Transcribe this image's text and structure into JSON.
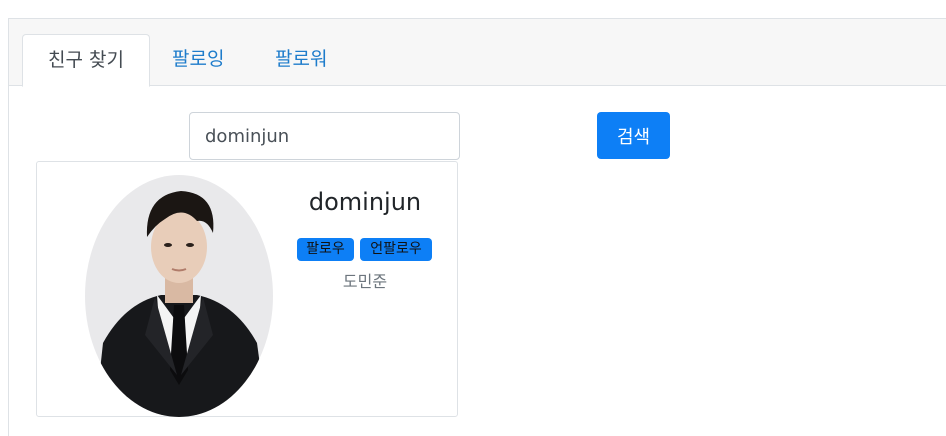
{
  "tabs": [
    {
      "label": "친구 찾기",
      "active": true
    },
    {
      "label": "팔로잉",
      "active": false
    },
    {
      "label": "팔로워",
      "active": false
    }
  ],
  "search": {
    "value": "dominjun",
    "button_label": "검색"
  },
  "result_card": {
    "username": "dominjun",
    "follow_label": "팔로우",
    "unfollow_label": "언팔로우",
    "real_name": "도민준"
  },
  "colors": {
    "accent": "#0d7ff6",
    "tab_link": "#1e7ccb",
    "tabbar_bg": "#f7f7f7"
  },
  "icons": {
    "avatar": "profile-photo"
  }
}
